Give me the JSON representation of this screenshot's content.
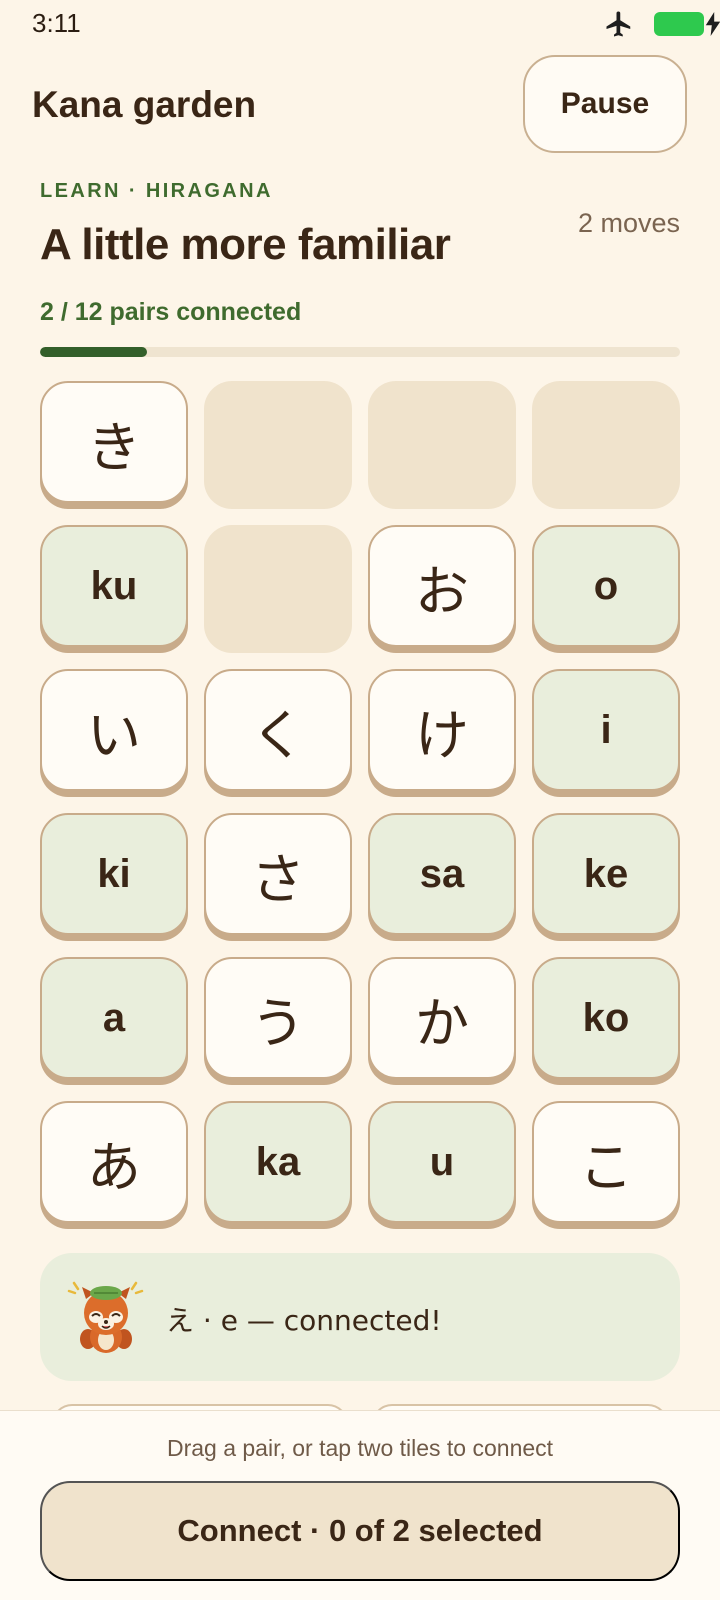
{
  "status_bar": {
    "time": "3:11",
    "icons": [
      "airplane-mode-icon",
      "battery-icon",
      "charging-bolt-icon"
    ],
    "battery_color": "#2ec94e"
  },
  "header": {
    "title": "Kana garden",
    "pause_label": "Pause"
  },
  "lesson": {
    "section_label": "LEARN · HIRAGANA",
    "title": "A little more familiar",
    "moves": "2 moves",
    "progress_text": "2 / 12 pairs connected",
    "progress_fraction": 0.1667
  },
  "tiles": [
    {
      "type": "kana",
      "text": "き"
    },
    {
      "type": "empty",
      "text": ""
    },
    {
      "type": "empty",
      "text": ""
    },
    {
      "type": "empty",
      "text": ""
    },
    {
      "type": "romaji",
      "text": "ku"
    },
    {
      "type": "empty",
      "text": ""
    },
    {
      "type": "kana",
      "text": "お"
    },
    {
      "type": "romaji",
      "text": "o"
    },
    {
      "type": "kana",
      "text": "い"
    },
    {
      "type": "kana",
      "text": "く"
    },
    {
      "type": "kana",
      "text": "け"
    },
    {
      "type": "romaji",
      "text": "i"
    },
    {
      "type": "romaji",
      "text": "ki"
    },
    {
      "type": "kana",
      "text": "さ"
    },
    {
      "type": "romaji",
      "text": "sa"
    },
    {
      "type": "romaji",
      "text": "ke"
    },
    {
      "type": "romaji",
      "text": "a"
    },
    {
      "type": "kana",
      "text": "う"
    },
    {
      "type": "kana",
      "text": "か"
    },
    {
      "type": "romaji",
      "text": "ko"
    },
    {
      "type": "kana",
      "text": "あ"
    },
    {
      "type": "romaji",
      "text": "ka"
    },
    {
      "type": "romaji",
      "text": "u"
    },
    {
      "type": "kana",
      "text": "こ"
    }
  ],
  "feedback": {
    "mascot": "red-panda-mascot-icon",
    "text": "え · e — connected!"
  },
  "footer": {
    "hint": "Drag a pair, or tap two tiles to connect",
    "connect_label": "Connect · 0 of 2 selected"
  },
  "colors": {
    "accent_green": "#3f6b2e",
    "progress_fill": "#335f2a",
    "background": "#fdf5e8",
    "romaji_tile": "#e9eedc",
    "empty_tile": "#f0e3cc"
  }
}
